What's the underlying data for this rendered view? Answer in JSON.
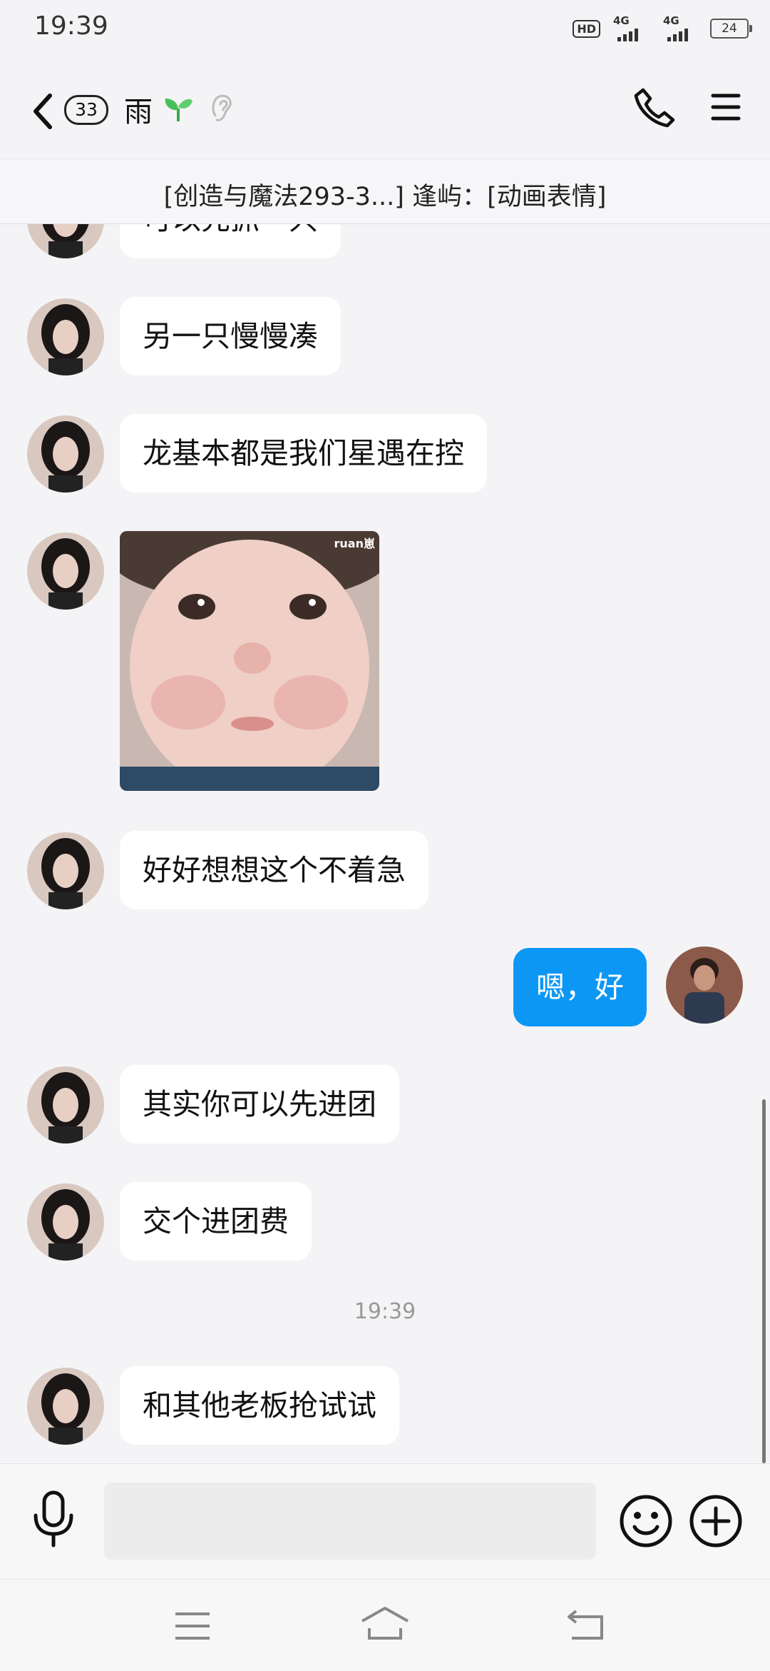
{
  "status_bar": {
    "time": "19:39",
    "hd": "HD",
    "net1": "4G",
    "net2": "4G",
    "battery": "24"
  },
  "header": {
    "unread_count": "33",
    "contact_name": "雨"
  },
  "pinned": {
    "text": "[创造与魔法293-3...] 逢屿：[动画表情]"
  },
  "messages": [
    {
      "side": "left",
      "type": "text",
      "text": "可以先抓一只"
    },
    {
      "side": "left",
      "type": "text",
      "text": "另一只慢慢凑"
    },
    {
      "side": "left",
      "type": "text",
      "text": "龙基本都是我们星遇在控"
    },
    {
      "side": "left",
      "type": "sticker",
      "tag": "ruan崽"
    },
    {
      "side": "left",
      "type": "text",
      "text": "好好想想这个不着急"
    },
    {
      "side": "right",
      "type": "text",
      "text": "嗯，好"
    },
    {
      "side": "left",
      "type": "text",
      "text": "其实你可以先进团"
    },
    {
      "side": "left",
      "type": "text",
      "text": "交个进团费"
    },
    {
      "side": "left",
      "type": "text",
      "text": "和其他老板抢试试"
    }
  ],
  "time_divider": "19:39",
  "input": {
    "placeholder": ""
  },
  "colors": {
    "accent": "#0d97f5",
    "background": "#f4f4f6",
    "bubble": "#ffffff"
  }
}
